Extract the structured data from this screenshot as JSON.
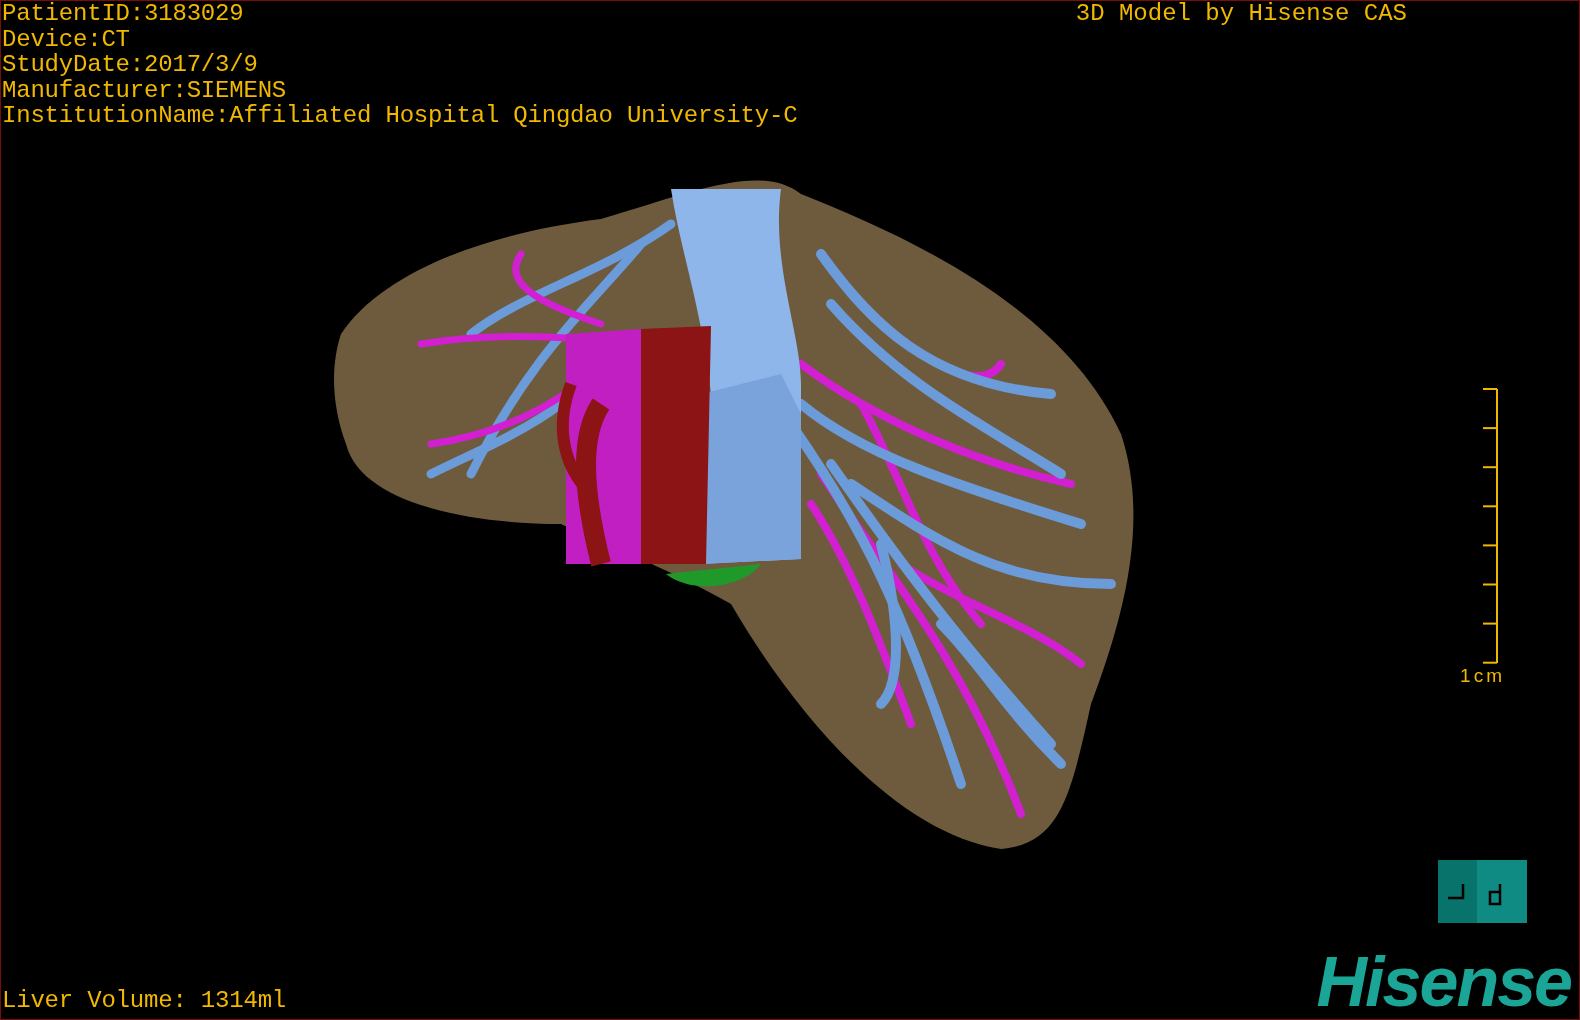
{
  "header": {
    "fields": [
      "PatientID:3183029",
      "Device:CT",
      "StudyDate:2017/3/9",
      "Manufacturer:SIEMENS",
      "InstitutionName:Affiliated Hospital Qingdao University-C"
    ],
    "title": "3D Model by Hisense CAS"
  },
  "scale_bar": {
    "label": "1cm"
  },
  "footer": {
    "volume": "Liver Volume: 1314ml"
  },
  "logo": {
    "text": "Hisense"
  }
}
